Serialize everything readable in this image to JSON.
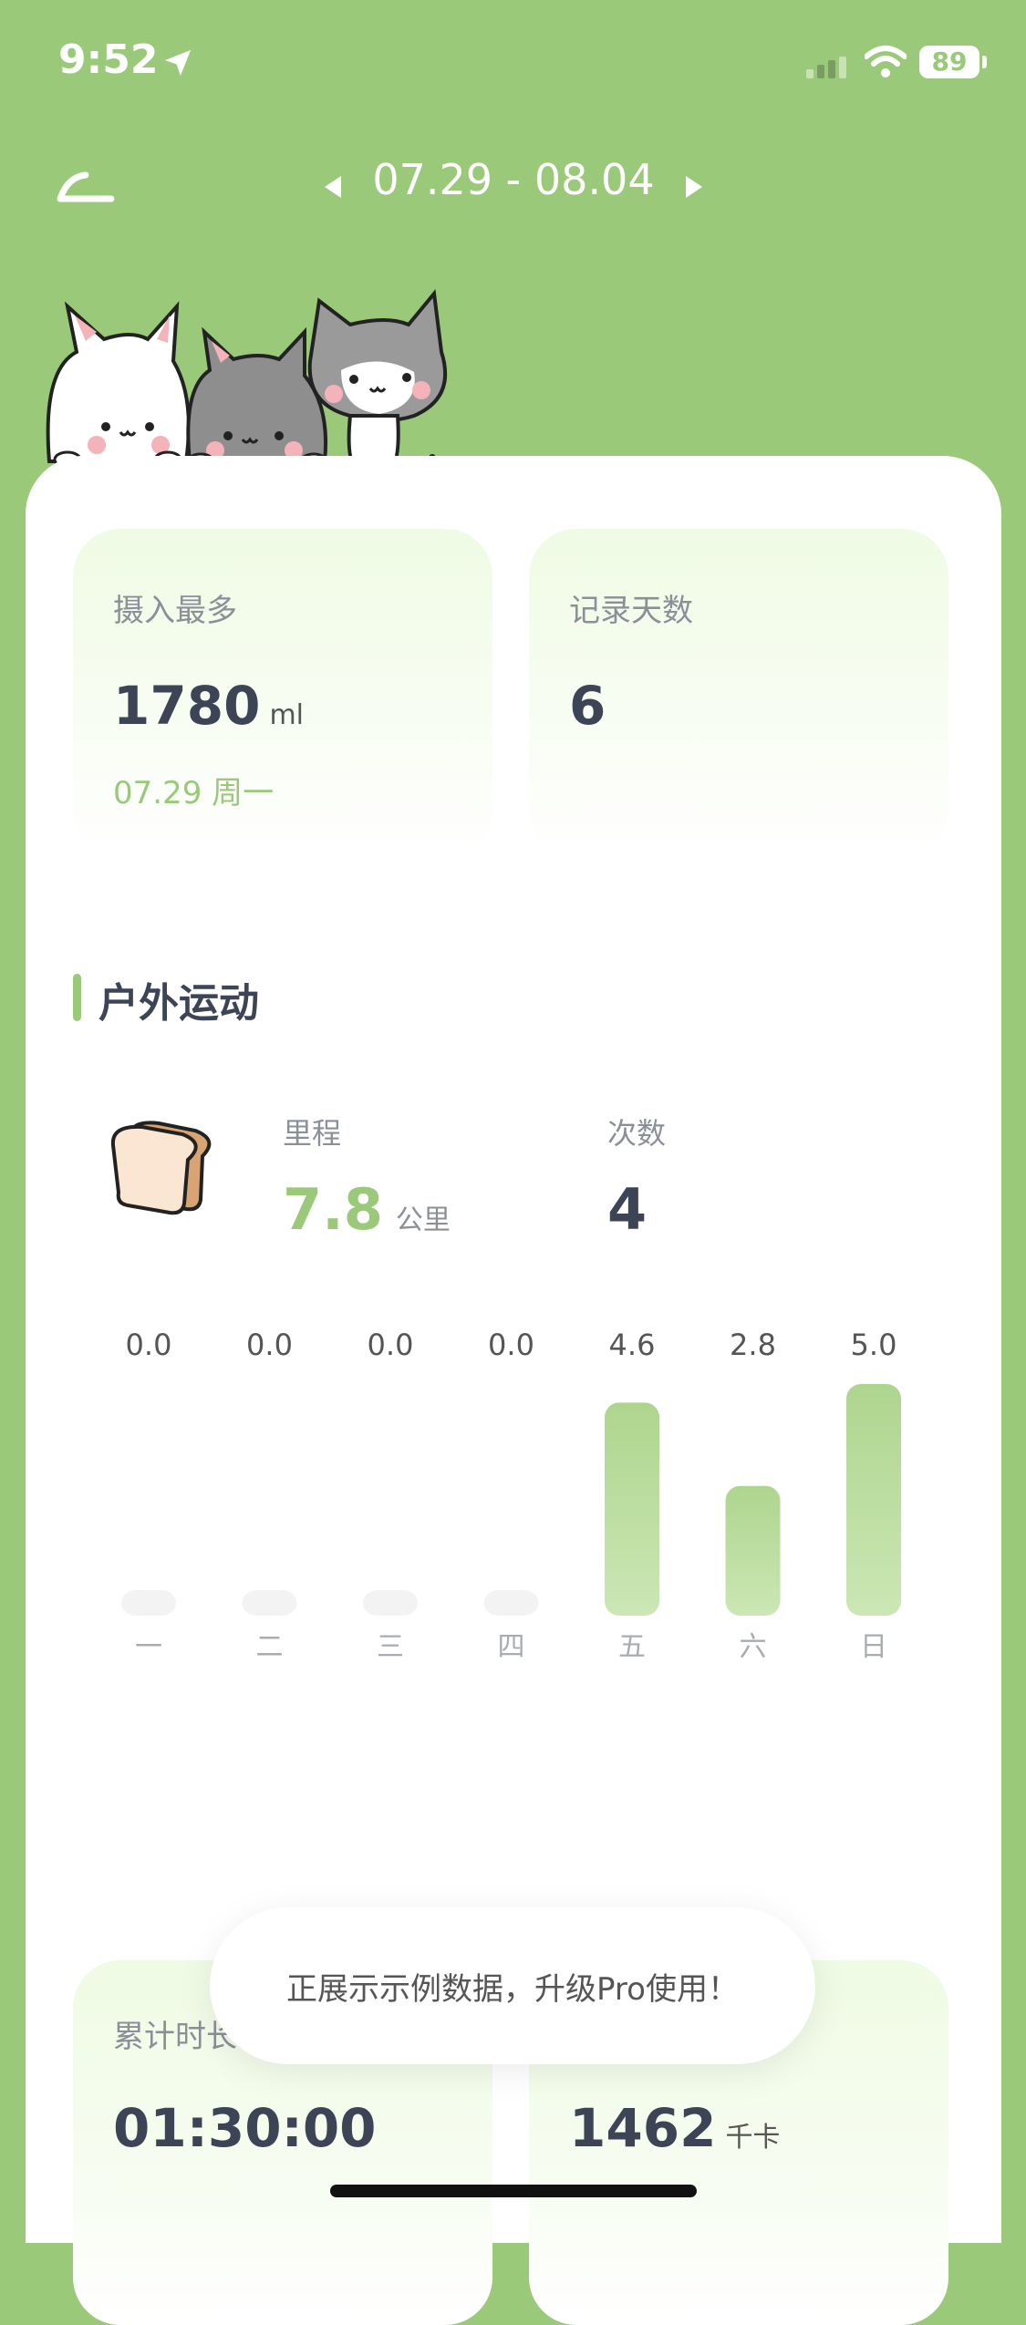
{
  "status_bar": {
    "time": "9:52",
    "battery": "89"
  },
  "header": {
    "date_range": "07.29 - 08.04"
  },
  "stats": {
    "intake_max": {
      "label": "摄入最多",
      "value": "1780",
      "unit": "ml",
      "date": "07.29 周一"
    },
    "record_days": {
      "label": "记录天数",
      "value": "6"
    }
  },
  "outdoor": {
    "title": "户外运动",
    "distance": {
      "label": "里程",
      "value": "7.8",
      "unit": "公里"
    },
    "count": {
      "label": "次数",
      "value": "4"
    }
  },
  "chart_data": {
    "type": "bar",
    "categories": [
      "一",
      "二",
      "三",
      "四",
      "五",
      "六",
      "日"
    ],
    "values": [
      0.0,
      0.0,
      0.0,
      0.0,
      4.6,
      2.8,
      5.0
    ],
    "value_labels": [
      "0.0",
      "0.0",
      "0.0",
      "0.0",
      "4.6",
      "2.8",
      "5.0"
    ],
    "ylim": [
      0,
      5.0
    ],
    "bar_color": "#b3da94",
    "empty_color": "#f3f3f3"
  },
  "bottom": {
    "duration": {
      "label": "累计时长",
      "value": "01:30:00"
    },
    "calories": {
      "value": "1462",
      "unit": "千卡"
    }
  },
  "toast": {
    "text": "正展示示例数据，升级Pro使用！"
  },
  "colors": {
    "background": "#9bc97a",
    "accent": "#9bc97a",
    "text": "#3c4456"
  }
}
